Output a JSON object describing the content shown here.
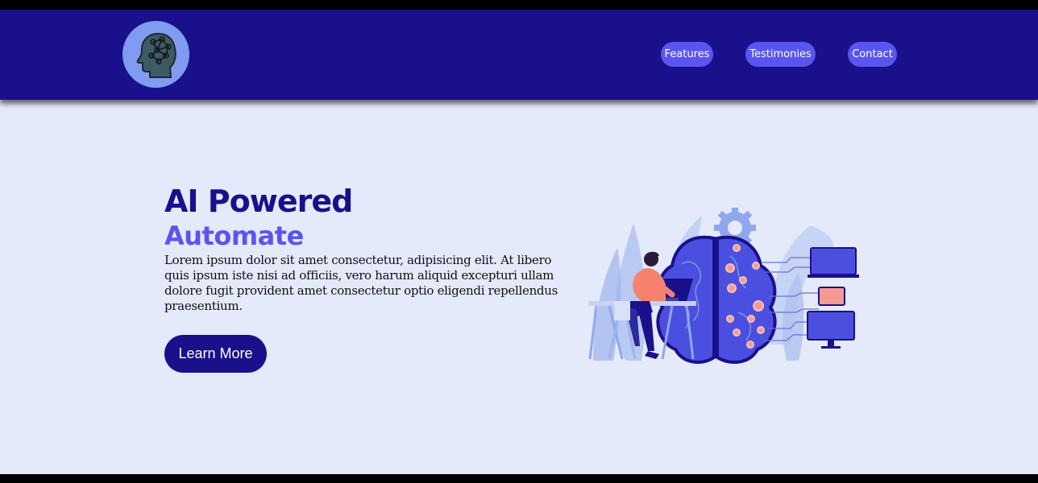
{
  "header": {
    "logo_icon": "brain-head-icon",
    "nav": [
      {
        "label": "Features"
      },
      {
        "label": "Testimonies"
      },
      {
        "label": "Contact"
      }
    ]
  },
  "hero": {
    "title": "AI Powered",
    "subtitle": "Automate",
    "body": "Lorem ipsum dolor sit amet consectetur, adipisicing elit. At libero quis ipsum iste nisi ad officiis, vero harum aliquid excepturi ullam dolore fugit provident amet consectetur optio eligendi repellendus praesentium.",
    "cta_label": "Learn More",
    "illustration_icon": "ai-brain-illustration"
  },
  "colors": {
    "header_bg": "#1a108c",
    "accent": "#5a55ef",
    "page_bg": "#e4eaf9",
    "logo_bg": "#7f9cf0"
  }
}
